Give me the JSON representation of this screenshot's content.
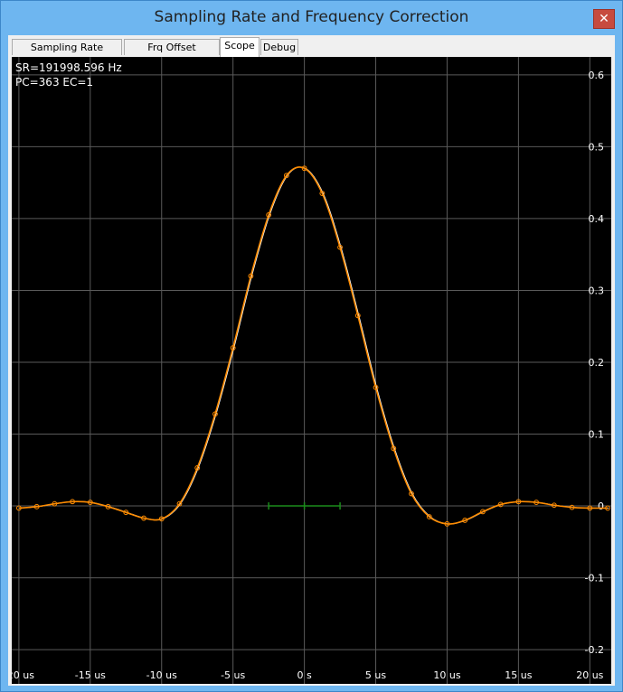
{
  "window": {
    "title": "Sampling Rate and Frequency Correction",
    "close_glyph": "✕"
  },
  "tabs": [
    {
      "label": "Sampling Rate Detector",
      "active": false
    },
    {
      "label": "Frq Offset Detector",
      "active": false
    },
    {
      "label": "Scope",
      "active": true
    },
    {
      "label": "Debug",
      "active": false
    }
  ],
  "scope": {
    "sr_label": "SR=191998.596 Hz",
    "pc_label": "PC=363 EC=1"
  },
  "colors": {
    "trace": "#ff8c00",
    "trace2": "#ffffff",
    "grid": "#5a5a5a",
    "marker": "#1a8c1a"
  },
  "chart_data": {
    "type": "line",
    "title": "",
    "xlabel": "",
    "ylabel": "",
    "xlim": [
      -20.5,
      21.5
    ],
    "ylim": [
      -0.22,
      0.625
    ],
    "x_ticks": [
      -20,
      -15,
      -10,
      -5,
      0,
      5,
      10,
      15,
      20
    ],
    "x_tick_labels": [
      "-20 us",
      "-15 us",
      "-10 us",
      "-5 us",
      "0 s",
      "5 us",
      "10 us",
      "15 us",
      "20 us"
    ],
    "y_ticks": [
      0.6,
      0.5,
      0.4,
      0.3,
      0.2,
      0.1,
      0,
      -0.1,
      -0.2
    ],
    "y_tick_labels": [
      "0.6",
      "0.5",
      "0.4",
      "0.3",
      "0.2",
      "0.1",
      "0",
      "-0.1",
      "-0.2"
    ],
    "grid": true,
    "series": [
      {
        "x": [
          -20,
          -18.75,
          -17.5,
          -16.25,
          -15,
          -13.75,
          -12.5,
          -11.25,
          -10,
          -8.75,
          -7.5,
          -6.25,
          -5,
          -3.75,
          -2.5,
          -1.25,
          0,
          1.25,
          2.5,
          3.75,
          5,
          6.25,
          7.5,
          8.75,
          10,
          11.25,
          12.5,
          13.75,
          15,
          16.25,
          17.5,
          18.75,
          20,
          21.25
        ],
        "y": [
          -0.003,
          -0.001,
          0.003,
          0.006,
          0.005,
          -0.001,
          -0.009,
          -0.017,
          -0.018,
          0.003,
          0.053,
          0.128,
          0.22,
          0.32,
          0.405,
          0.46,
          0.47,
          0.435,
          0.36,
          0.265,
          0.165,
          0.08,
          0.017,
          -0.015,
          -0.025,
          -0.02,
          -0.008,
          0.002,
          0.006,
          0.005,
          0.001,
          -0.002,
          -0.003,
          -0.003
        ]
      }
    ],
    "marker_range": [
      -2.5,
      2.5
    ],
    "marker_y": 0
  }
}
